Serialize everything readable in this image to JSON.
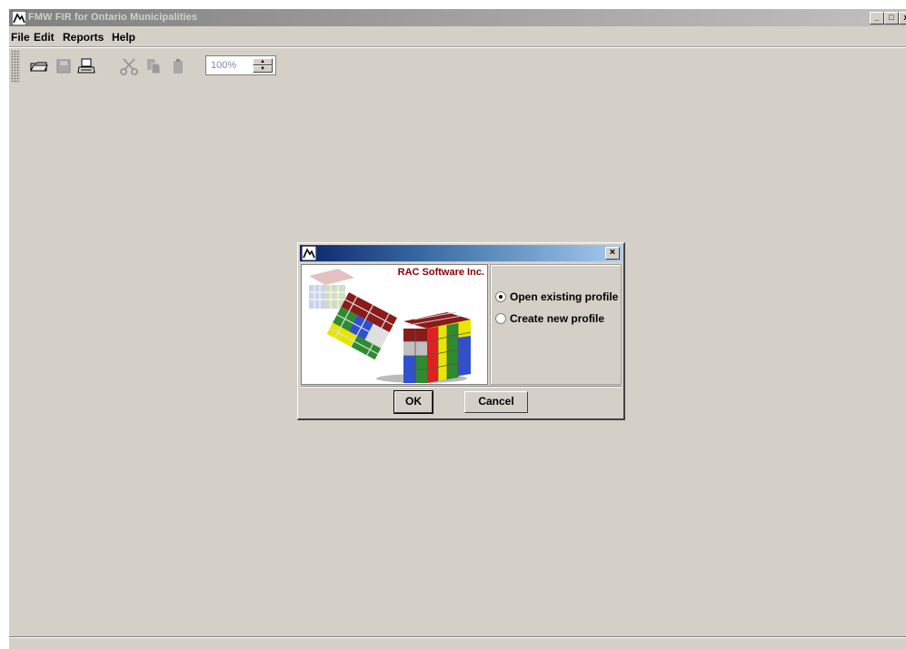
{
  "window": {
    "title": "FMW FIR for Ontario Municipalities",
    "controls": {
      "minimize": "_",
      "maximize": "□",
      "close": "x"
    }
  },
  "menu": {
    "items": [
      {
        "label": "File"
      },
      {
        "label": "Edit"
      },
      {
        "label": "Reports"
      },
      {
        "label": "Help"
      }
    ]
  },
  "toolbar": {
    "buttons": [
      "open-folder-icon",
      "save-icon",
      "print-icon",
      "cut-icon",
      "copy-icon",
      "paste-icon"
    ],
    "zoom_value": "100%"
  },
  "dialog": {
    "close_label": "×",
    "company": "RAC Software Inc.",
    "options": [
      {
        "label": "Open existing profile",
        "checked": true
      },
      {
        "label": "Create new profile",
        "checked": false
      }
    ],
    "ok_label": "OK",
    "cancel_label": "Cancel"
  }
}
